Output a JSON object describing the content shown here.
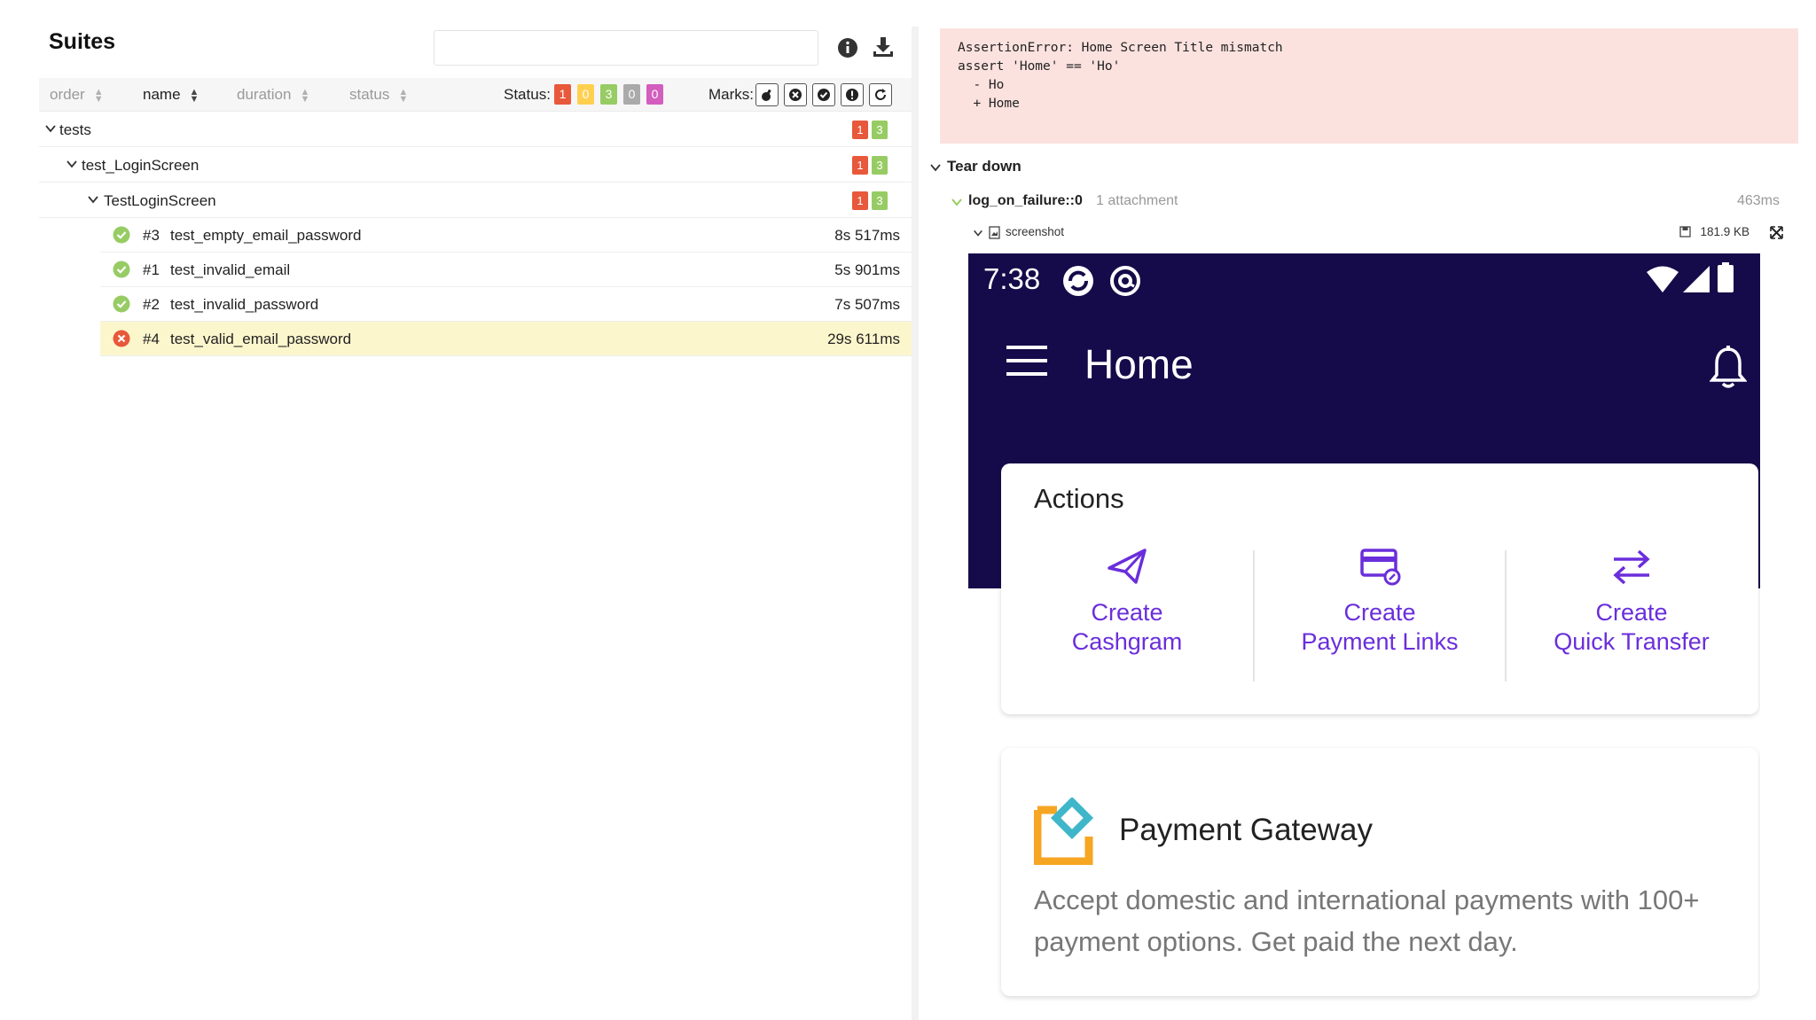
{
  "left": {
    "title": "Suites",
    "sort": {
      "order": "order",
      "name": "name",
      "duration": "duration",
      "status": "status"
    },
    "status_label": "Status:",
    "status_counts": [
      {
        "value": "1",
        "color": "#e8583b"
      },
      {
        "value": "0",
        "color": "#ffd050"
      },
      {
        "value": "3",
        "color": "#97cc64"
      },
      {
        "value": "0",
        "color": "#aaaaaa"
      },
      {
        "value": "0",
        "color": "#d35ebe"
      }
    ],
    "marks_label": "Marks:",
    "marks": [
      "flaky-icon",
      "new-failed-icon",
      "new-passed-icon",
      "new-broken-icon",
      "retries-icon"
    ],
    "tree": [
      {
        "label": "tests",
        "failed": "1",
        "passed": "3"
      },
      {
        "label": "test_LoginScreen",
        "failed": "1",
        "passed": "3"
      },
      {
        "label": "TestLoginScreen",
        "failed": "1",
        "passed": "3"
      }
    ],
    "tests": [
      {
        "num": "#3",
        "name": "test_empty_email_password",
        "duration": "8s 517ms",
        "status": "passed"
      },
      {
        "num": "#1",
        "name": "test_invalid_email",
        "duration": "5s 901ms",
        "status": "passed"
      },
      {
        "num": "#2",
        "name": "test_invalid_password",
        "duration": "7s 507ms",
        "status": "passed"
      },
      {
        "num": "#4",
        "name": "test_valid_email_password",
        "duration": "29s 611ms",
        "status": "failed"
      }
    ]
  },
  "right": {
    "error_text": "AssertionError: Home Screen Title mismatch\nassert 'Home' == 'Ho'\n  - Ho\n  + Home",
    "teardown_label": "Tear down",
    "fixture_name": "log_on_failure::0",
    "fixture_attachments": "1 attachment",
    "fixture_time": "463ms",
    "attachment_name": "screenshot",
    "attachment_size": "181.9 KB",
    "phone": {
      "clock": "7:38",
      "title": "Home",
      "actions_title": "Actions",
      "actions": [
        {
          "line1": "Create",
          "line2": "Cashgram"
        },
        {
          "line1": "Create",
          "line2": "Payment Links"
        },
        {
          "line1": "Create",
          "line2": "Quick Transfer"
        }
      ],
      "pg_title": "Payment Gateway",
      "pg_desc": "Accept domestic and international payments with 100+ payment options. Get paid the next day."
    }
  }
}
